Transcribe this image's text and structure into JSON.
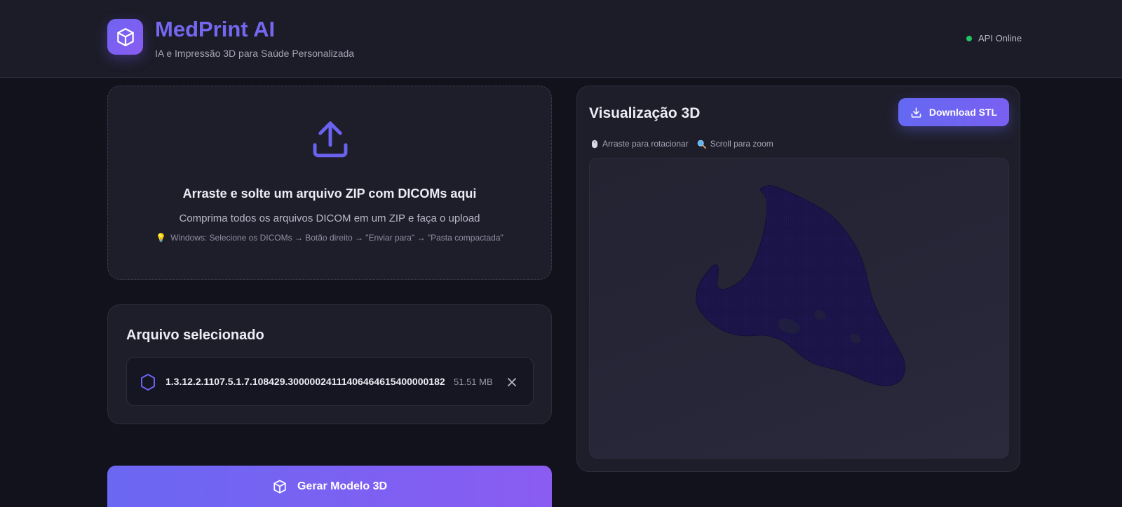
{
  "header": {
    "brand_title": "MedPrint AI",
    "brand_subtitle": "IA e Impressão 3D para Saúde Personalizada",
    "api_status": "API Online",
    "status_color": "#22c55e"
  },
  "dropzone": {
    "title": "Arraste e solte um arquivo ZIP com DICOMs aqui",
    "subtitle": "Comprima todos os arquivos DICOM em um ZIP e faça o upload",
    "tip": "Windows: Selecione os DICOMs → Botão direito → \"Enviar para\" → \"Pasta compactada\"",
    "icon": "upload-icon"
  },
  "selected_file": {
    "title": "Arquivo selecionado",
    "file_name": "1.3.12.2.1107.5.1.7.108429.30000024111406464615400000182",
    "file_size": "51.51 MB"
  },
  "generate": {
    "label": "Gerar Modelo 3D"
  },
  "viewer": {
    "title": "Visualização 3D",
    "download_label": "Download STL",
    "hint_rotate": "Arraste para rotacionar",
    "hint_zoom": "Scroll para zoom",
    "model_color": "#1a1446"
  },
  "colors": {
    "accent": "#6f63f0",
    "accent_secondary": "#8a5cf2",
    "background": "#12121c",
    "card": "#1e1e2b"
  }
}
